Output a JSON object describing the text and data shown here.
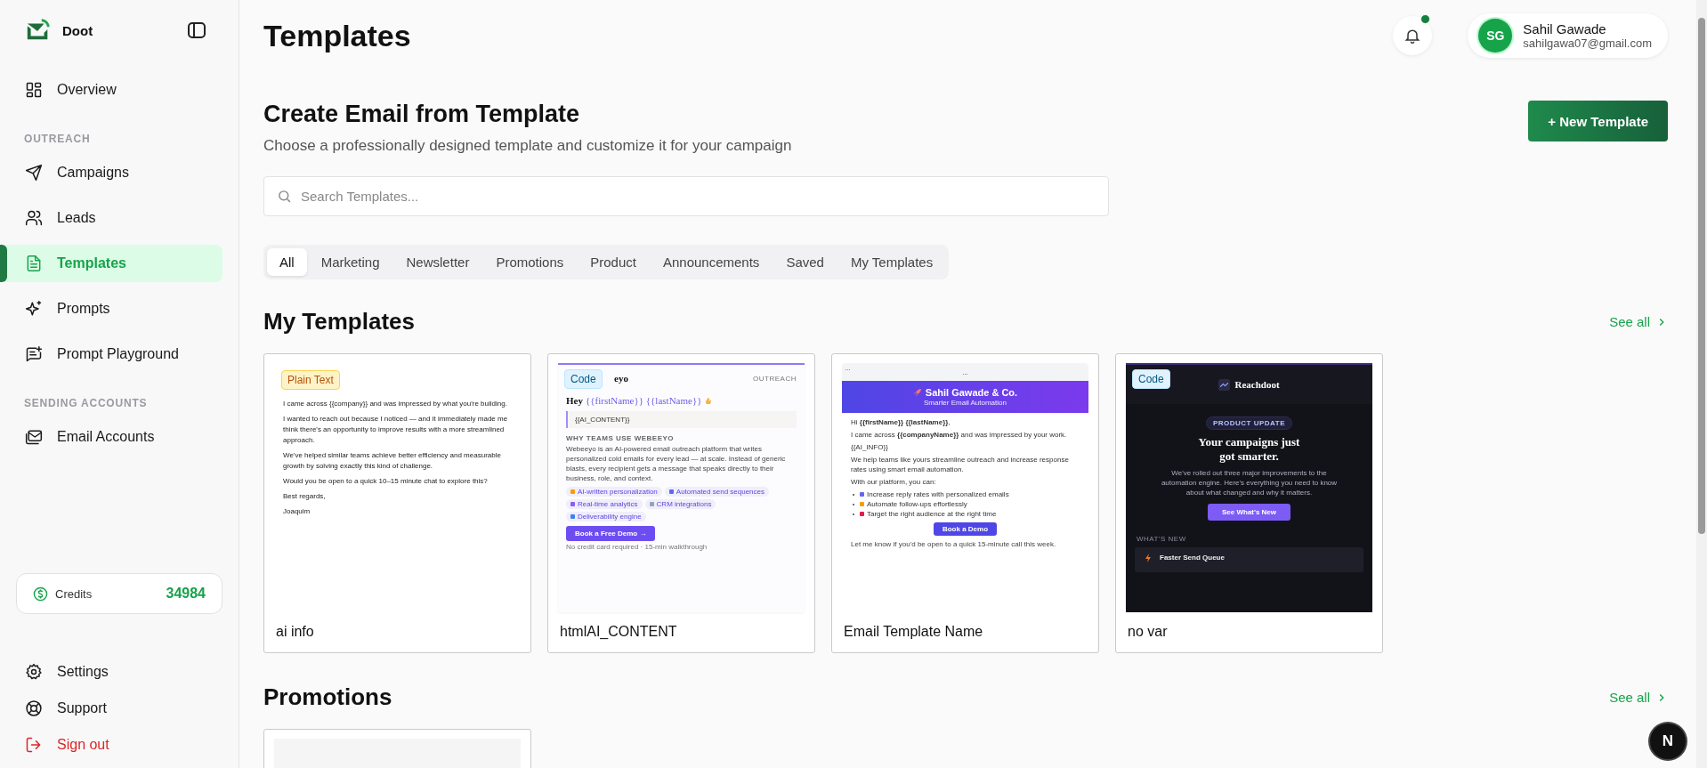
{
  "app": {
    "name": "Doot",
    "dev_badge": "N"
  },
  "nav": [
    {
      "kind": "item",
      "label": "Overview",
      "selected": false
    },
    {
      "kind": "section",
      "label": "OUTREACH"
    },
    {
      "kind": "item",
      "label": "Campaigns",
      "selected": false
    },
    {
      "kind": "item",
      "label": "Leads",
      "selected": false
    },
    {
      "kind": "item",
      "label": "Templates",
      "selected": true
    },
    {
      "kind": "item",
      "label": "Prompts",
      "selected": false
    },
    {
      "kind": "item",
      "label": "Prompt Playground",
      "selected": false
    },
    {
      "kind": "section",
      "label": "SENDING ACCOUNTS"
    },
    {
      "kind": "item",
      "label": "Email Accounts",
      "selected": false
    }
  ],
  "credits": {
    "label": "Credits",
    "value": "34984"
  },
  "bottom_nav": [
    {
      "label": "Settings",
      "danger": false
    },
    {
      "label": "Support",
      "danger": false
    },
    {
      "label": "Sign out",
      "danger": true
    }
  ],
  "header": {
    "title": "Templates",
    "unread": true,
    "user": {
      "initials": "SG",
      "name": "Sahil Gawade",
      "email": "sahilgawa07@gmail.com"
    }
  },
  "intro": {
    "title": "Create Email from Template",
    "subtitle": "Choose a professionally designed template and customize it for your campaign",
    "button": "+ New Template"
  },
  "search": {
    "placeholder": "Search Templates..."
  },
  "tabs": [
    {
      "label": "All",
      "selected": true
    },
    {
      "label": "Marketing",
      "selected": false
    },
    {
      "label": "Newsletter",
      "selected": false
    },
    {
      "label": "Promotions",
      "selected": false
    },
    {
      "label": "Product",
      "selected": false
    },
    {
      "label": "Announcements",
      "selected": false
    },
    {
      "label": "Saved",
      "selected": false
    },
    {
      "label": "My Templates",
      "selected": false
    }
  ],
  "sections": [
    {
      "title": "My Templates",
      "link": "See all",
      "cards": [
        {
          "name": "ai info",
          "badge": {
            "kind": "plain",
            "label": "Plain Text"
          },
          "preview": {
            "kind": "plain",
            "paragraphs": [
              "I came across {{company}} and was impressed by what you're building.",
              "I wanted to reach out because I noticed — and it immediately made me think there's an opportunity to improve results with a more streamlined approach.",
              "We've helped similar teams achieve better efficiency and measurable growth by solving exactly this kind of challenge.",
              "Would you be open to a quick 10–15 minute chat to explore this?",
              "Best regards,",
              "Joaquim"
            ]
          }
        },
        {
          "name": "htmlAI_CONTENT",
          "badge": {
            "kind": "code",
            "label": "Code"
          },
          "preview": {
            "kind": "outreach",
            "brand": "eyo",
            "tag": "OUTREACH",
            "greeting": "Hey",
            "vars": "{{firstName}} {{lastName}}",
            "quote": "{{AI_CONTENT}}",
            "section": "WHY TEAMS USE WEBEEYO",
            "body": "Webeeyo is an AI-powered email outreach platform that writes personalized cold emails for every lead — at scale. Instead of generic blasts, every recipient gets a message that speaks directly to their business, role, and context.",
            "chips": [
              {
                "label": "AI-written personalization",
                "color": "#f59e0b"
              },
              {
                "label": "Automated send sequences",
                "color": "#6366f1"
              },
              {
                "label": "Real-time analytics",
                "color": "#8b5cf6"
              },
              {
                "label": "CRM integrations",
                "color": "#94a3b8"
              },
              {
                "label": "Deliverability engine",
                "color": "#3b82f6"
              }
            ],
            "button": "Book a Free Demo →",
            "note": "No credit card required · 15-min walkthrough"
          }
        },
        {
          "name": "Email Template Name",
          "preview": {
            "kind": "banner",
            "corner": "...",
            "bar": "...",
            "title": "Sahil Gawade & Co.",
            "subtitle": "Smarter Email Automation",
            "paragraphs": [
              "Hi **{{firstName}}** **{{lastName}}**,",
              "I came across **{{companyName}}** and was impressed by your work.",
              "{{AI_INFO}}",
              "We help teams like yours streamline outreach and increase response rates using smart email automation.",
              "With our platform, you can:"
            ],
            "bullets": [
              {
                "label": "Increase reply rates with personalized emails",
                "color": "#6366f1"
              },
              {
                "label": "Automate follow-ups effortlessly",
                "color": "#f59e0b"
              },
              {
                "label": "Target the right audience at the right time",
                "color": "#e11d48"
              }
            ],
            "button": "Book a Demo",
            "footer": "Let me know if you'd be open to a quick 15-minute call this week."
          }
        },
        {
          "name": "no var",
          "badge": {
            "kind": "code",
            "label": "Code"
          },
          "preview": {
            "kind": "dark",
            "brand": "Reachdoot",
            "pill": "PRODUCT UPDATE",
            "headline": "Your campaigns just got smarter.",
            "body": "We've rolled out three major improvements to the automation engine. Here's everything you need to know about what changed and why it matters.",
            "button": "See What's New",
            "section": "WHAT'S NEW",
            "item": "Faster Send Queue"
          }
        }
      ]
    },
    {
      "title": "Promotions",
      "link": "See all",
      "cards": [
        {
          "preview": {
            "kind": "blank"
          }
        }
      ]
    }
  ]
}
